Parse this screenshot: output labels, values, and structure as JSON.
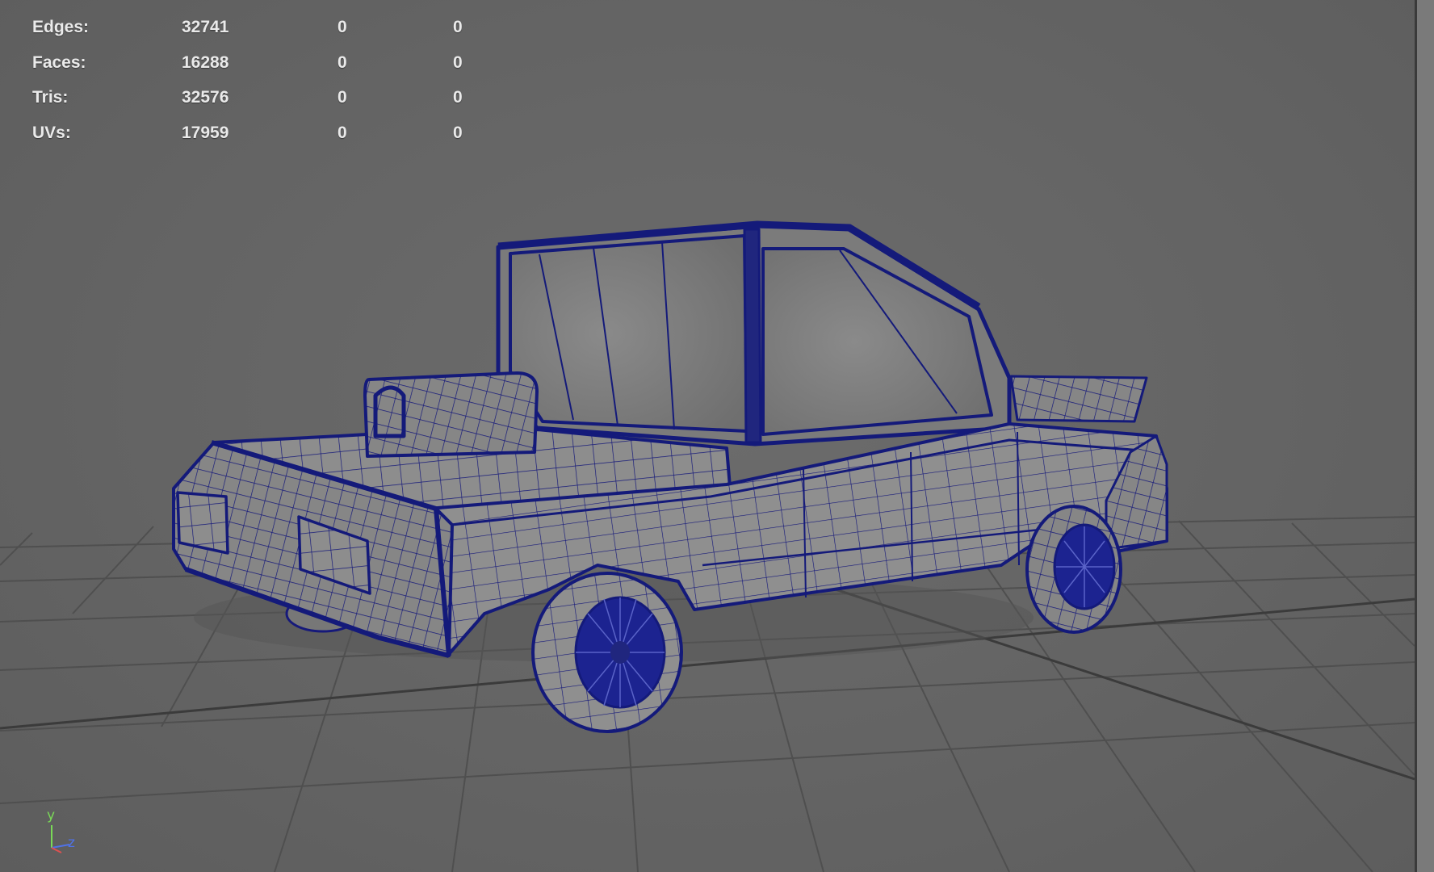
{
  "hud": {
    "rows": [
      {
        "label": "Edges:",
        "total": "32741",
        "selected": "0",
        "selected2": "0"
      },
      {
        "label": "Faces:",
        "total": "16288",
        "selected": "0",
        "selected2": "0"
      },
      {
        "label": "Tris:",
        "total": "32576",
        "selected": "0",
        "selected2": "0"
      },
      {
        "label": "UVs:",
        "total": "17959",
        "selected": "0",
        "selected2": "0"
      }
    ]
  },
  "axis_gizmo": {
    "y_label": "y",
    "z_label": "z"
  },
  "colors": {
    "viewport_bg": "#646464",
    "grid_line": "#4d4d4d",
    "grid_axis": "#3c3c3c",
    "wire": "#141a7a",
    "body_fill": "#8a8a8a",
    "hud_text": "#eaeaea",
    "axis_y": "#7ad957",
    "axis_z": "#4f72e8"
  },
  "model": {
    "name_icon": "car-wireframe-model"
  }
}
